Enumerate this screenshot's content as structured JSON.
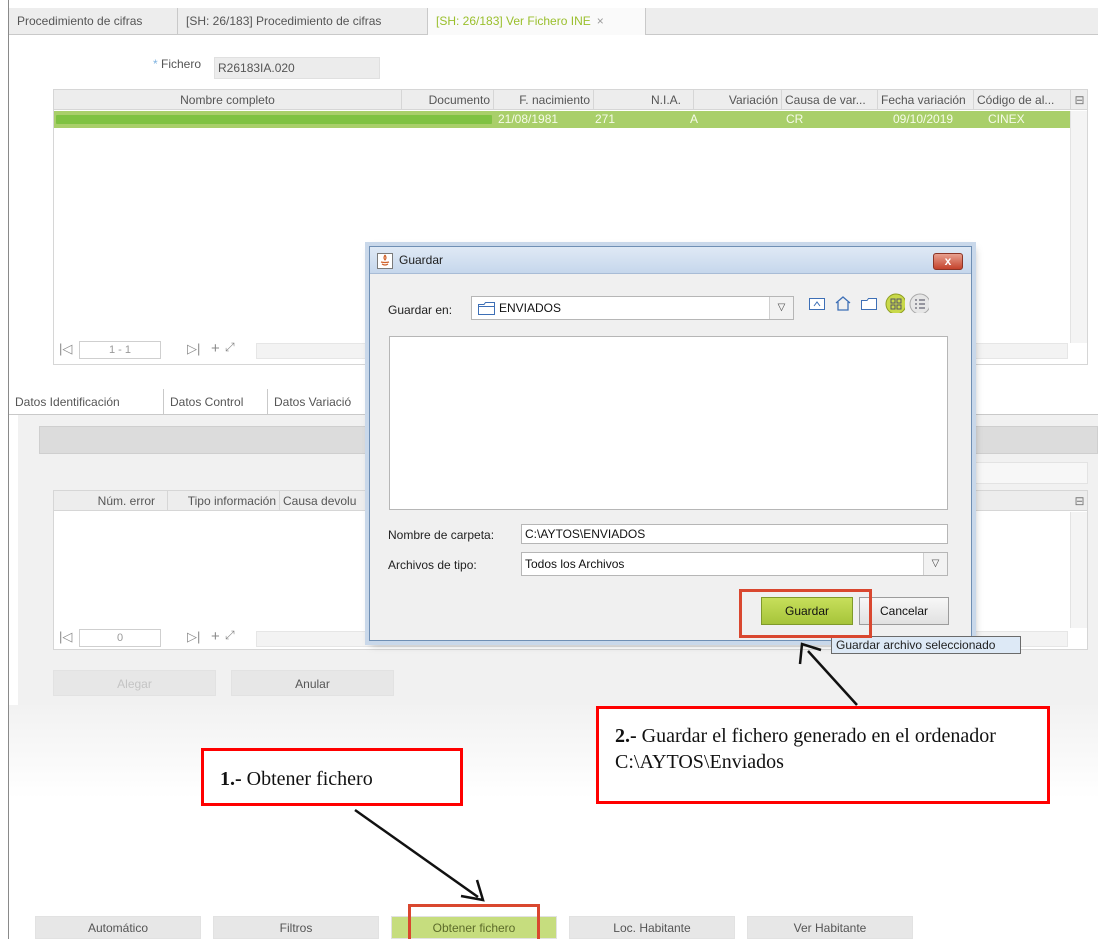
{
  "tabs": [
    {
      "label": "Procedimiento de cifras"
    },
    {
      "label": "[SH: 26/183] Procedimiento de cifras"
    },
    {
      "label": "[SH: 26/183] Ver Fichero INE",
      "close": "×"
    }
  ],
  "fichero": {
    "label": "Fichero",
    "required_mark": "*",
    "value": "R26183IA.020"
  },
  "grid1": {
    "columns": [
      "Nombre completo",
      "Documento",
      "F. nacimiento",
      "N.I.A.",
      "Variación",
      "Causa de var...",
      "Fecha variación",
      "Código de al..."
    ],
    "rows": [
      {
        "fecha_nacimiento": "21/08/1981",
        "nia": "271",
        "variacion": "A",
        "causa": "CR",
        "fecha_variacion": "09/10/2019",
        "codigo": "CINEX"
      }
    ],
    "pager": "1 - 1"
  },
  "lower_tabs": [
    "Datos Identificación",
    "Datos Control",
    "Datos Variació"
  ],
  "grid2": {
    "columns": [
      "Núm. error",
      "Tipo información",
      "Causa devolu"
    ],
    "pager": "0"
  },
  "panel_buttons": {
    "alegar": "Alegar",
    "anular": "Anular"
  },
  "bottom_buttons": [
    "Automático",
    "Filtros",
    "Obtener fichero",
    "Loc. Habitante",
    "Ver Habitante"
  ],
  "dialog": {
    "title": "Guardar",
    "save_in_label": "Guardar en:",
    "save_in_value": "ENVIADOS",
    "folder_label": "Nombre de carpeta:",
    "folder_value": "C:\\AYTOS\\ENVIADOS",
    "type_label": "Archivos de tipo:",
    "type_value": "Todos los Archivos",
    "save_button": "Guardar",
    "cancel_button": "Cancelar",
    "close": "x"
  },
  "tooltip": "Guardar archivo seleccionado",
  "annotations": {
    "note1": {
      "num": "1.-",
      "text": " Obtener fichero"
    },
    "note2": {
      "num": "2.-",
      "text": " Guardar el fichero generado en el ordenador C:\\AYTOS\\Enviados"
    }
  },
  "colors": {
    "accent_green": "#a9cf6a",
    "button_green": "#c6dd7e",
    "annotation_red": "#ff0000"
  }
}
